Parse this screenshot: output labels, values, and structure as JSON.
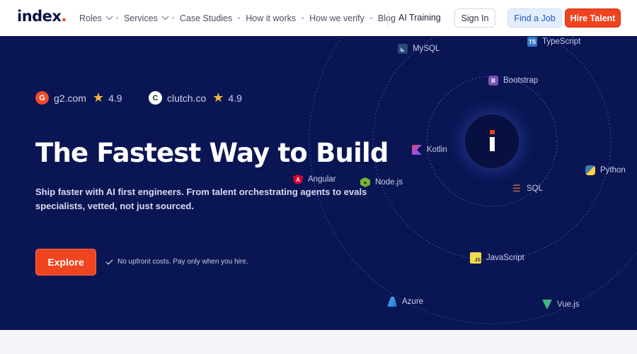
{
  "nav": {
    "logo_text": "index",
    "logo_dot": ".",
    "links": [
      {
        "label": "Roles",
        "dropdown": true
      },
      {
        "label": "Services",
        "dropdown": true
      },
      {
        "label": "Case Studies",
        "dropdown": false
      },
      {
        "label": "How it works",
        "dropdown": false
      },
      {
        "label": "How we verify",
        "dropdown": false
      },
      {
        "label": "Blog",
        "dropdown": false
      }
    ],
    "ai_training": "AI Training",
    "sign_in": "Sign In",
    "find_job": "Find a Job",
    "hire_talent": "Hire Talent"
  },
  "hero": {
    "ratings": [
      {
        "site": "g2.com",
        "score": "4.9",
        "icon": "g2-logo-icon"
      },
      {
        "site": "clutch.co",
        "score": "4.9",
        "icon": "clutch-logo-icon"
      }
    ],
    "headline": "The Fastest Way to Build",
    "subcopy": "Ship faster with AI first engineers. From talent orchestrating agents to evals specialists, vetted, not just sourced.",
    "cta": "Explore",
    "note": "No upfront costs. Pay only when you hire.",
    "technologies": [
      {
        "name": "MySQL",
        "icon": "mysql-icon",
        "color": "#5d87a1"
      },
      {
        "name": "TypeScript",
        "icon": "typescript-icon",
        "color": "#3178c6"
      },
      {
        "name": "Bootstrap",
        "icon": "bootstrap-icon",
        "color": "#7952b3"
      },
      {
        "name": "Kotlin",
        "icon": "kotlin-icon",
        "color": "#a24dd9"
      },
      {
        "name": "Python",
        "icon": "python-icon",
        "color": "#3f7cb8"
      },
      {
        "name": "Angular",
        "icon": "angular-icon",
        "color": "#dd0031"
      },
      {
        "name": "Node.js",
        "icon": "nodejs-icon",
        "color": "#7bb536"
      },
      {
        "name": "SQL",
        "icon": "database-icon",
        "color": "#d0744a"
      },
      {
        "name": "JavaScript",
        "icon": "javascript-icon",
        "color": "#f0db4f"
      },
      {
        "name": "Azure",
        "icon": "azure-icon",
        "color": "#1b8ad8"
      },
      {
        "name": "Vue.js",
        "icon": "vue-icon",
        "color": "#41b883"
      }
    ]
  },
  "colors": {
    "accent": "#f0431f",
    "hero_bg": "#0a1553",
    "nav_text": "#4b5063"
  }
}
